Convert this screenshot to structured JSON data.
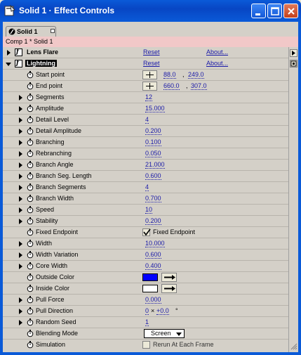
{
  "window": {
    "title": "Solid 1 · Effect Controls"
  },
  "tab": {
    "label": "Solid 1"
  },
  "comp_bar": {
    "text": "Comp 1 * Solid 1"
  },
  "effects": [
    {
      "name": "Lens Flare",
      "reset": "Reset",
      "about": "About..."
    },
    {
      "name": "Lightning",
      "reset": "Reset",
      "about": "About..."
    }
  ],
  "properties": {
    "start_point": {
      "label": "Start point",
      "x": "88.0",
      "y": "249.0"
    },
    "end_point": {
      "label": "End point",
      "x": "660.0",
      "y": "307.0"
    },
    "segments": {
      "label": "Segments",
      "value": "12"
    },
    "amplitude": {
      "label": "Amplitude",
      "value": "15.000"
    },
    "detail_level": {
      "label": "Detail Level",
      "value": "4"
    },
    "detail_amplitude": {
      "label": "Detail Amplitude",
      "value": "0.200"
    },
    "branching": {
      "label": "Branching",
      "value": "0.100"
    },
    "rebranching": {
      "label": "Rebranching",
      "value": "0.050"
    },
    "branch_angle": {
      "label": "Branch Angle",
      "value": "21.000"
    },
    "branch_seg_length": {
      "label": "Branch Seg. Length",
      "value": "0.600"
    },
    "branch_segments": {
      "label": "Branch Segments",
      "value": "4"
    },
    "branch_width": {
      "label": "Branch Width",
      "value": "0.700"
    },
    "speed": {
      "label": "Speed",
      "value": "10"
    },
    "stability": {
      "label": "Stability",
      "value": "0.200"
    },
    "fixed_endpoint": {
      "label": "Fixed Endpoint",
      "checkbox_label": "Fixed Endpoint",
      "checked": true
    },
    "width": {
      "label": "Width",
      "value": "10.000"
    },
    "width_variation": {
      "label": "Width Variation",
      "value": "0.600"
    },
    "core_width": {
      "label": "Core Width",
      "value": "0.400"
    },
    "outside_color": {
      "label": "Outside Color",
      "color": "#0000ff"
    },
    "inside_color": {
      "label": "Inside Color",
      "color": "#ffffff"
    },
    "pull_force": {
      "label": "Pull Force",
      "value": "0.000"
    },
    "pull_direction": {
      "label": "Pull Direction",
      "revolutions": "0",
      "x": "×",
      "degrees": "+0.0",
      "degree_symbol": "°"
    },
    "random_seed": {
      "label": "Random Seed",
      "value": "1"
    },
    "blending_mode": {
      "label": "Blending Mode",
      "value": "Screen"
    },
    "simulation": {
      "label": "Simulation",
      "checkbox_label": "Rerun At Each Frame",
      "checked": false
    }
  },
  "colors": {
    "title_blue": "#0a5ad8",
    "link_blue": "#1a1aa8",
    "comp_bar": "#f1c8c8",
    "panel": "#d4d0c8"
  }
}
